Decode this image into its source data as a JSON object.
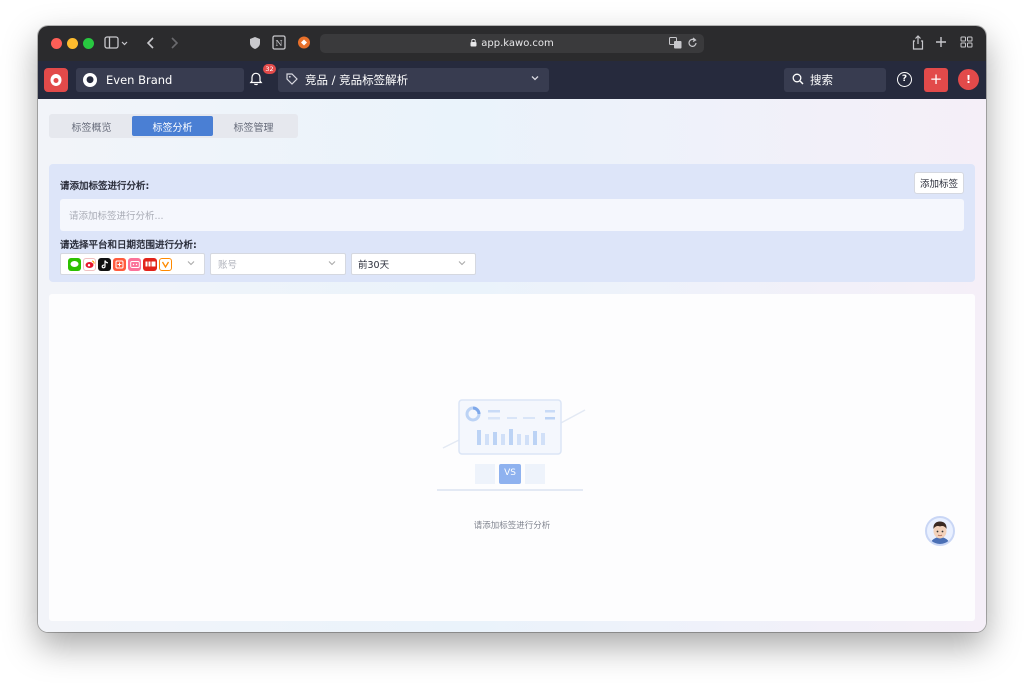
{
  "browser": {
    "url": "app.kawo.com"
  },
  "nav": {
    "logo_glyph": "●",
    "brand_name": "Even Brand",
    "notification_count": "32",
    "breadcrumb": "竞品 / 竞品标签解析",
    "search_label": "搜索",
    "help_glyph": "?",
    "add_glyph": "+",
    "alert_glyph": "!"
  },
  "tabs": [
    {
      "label": "标签概览",
      "active": false
    },
    {
      "label": "标签分析",
      "active": true
    },
    {
      "label": "标签管理",
      "active": false
    }
  ],
  "panel": {
    "add_tag_prompt": "请添加标签进行分析:",
    "add_tag_button": "添加标签",
    "tag_input_placeholder": "请添加标签进行分析...",
    "platform_date_prompt": "请选择平台和日期范围进行分析:",
    "platforms": [
      {
        "icon": "wechat-icon",
        "color": "#2dc100",
        "glyph": "✉"
      },
      {
        "icon": "weibo-icon",
        "color": "#e6162d",
        "glyph": "◉"
      },
      {
        "icon": "douyin-icon",
        "color": "#111111",
        "glyph": "♪"
      },
      {
        "icon": "xiaohongshu-icon",
        "color": "#ff2442",
        "glyph": "书"
      },
      {
        "icon": "bilibili-icon",
        "color": "#fb7299",
        "glyph": "b"
      },
      {
        "icon": "redbook-icon",
        "color": "#e2231a",
        "glyph": "小红"
      },
      {
        "icon": "kuaishou-icon",
        "color": "#ff8a00",
        "glyph": "◎"
      }
    ],
    "account_placeholder": "账号",
    "date_range": "前30天"
  },
  "empty_state": {
    "message": "请添加标签进行分析",
    "vs_label": "VS"
  },
  "colors": {
    "nav_bg": "#262a3d",
    "accent": "#4a7fd4",
    "brand_red": "#e24a4a",
    "panel_bg": "#dde5f9"
  }
}
